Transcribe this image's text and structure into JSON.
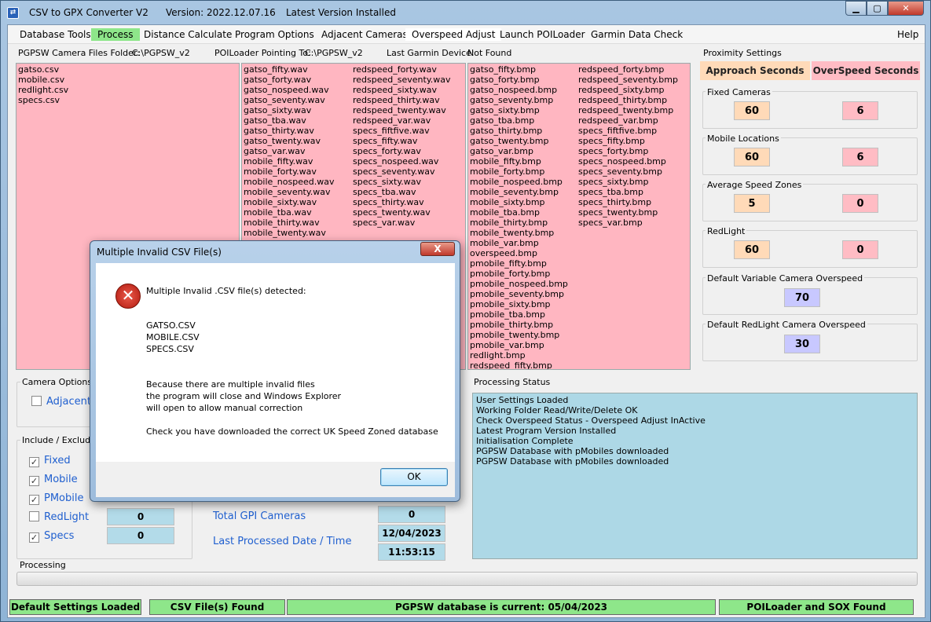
{
  "titlebar": {
    "app": "CSV to GPX Converter V2",
    "version": "Version: 2022.12.07.16",
    "status": "Latest Version Installed",
    "icon": "app-icon",
    "minimize": "minimize-icon",
    "maximize": "maximize-icon",
    "close": "close-icon"
  },
  "menu": [
    "Database Tools",
    "Process",
    "Distance Calculate",
    "Program Options",
    "Adjacent Cameras",
    "Overspeed Adjust",
    "Launch POILoader",
    "Garmin Data Check",
    "Help"
  ],
  "info": {
    "camera_folder_label": "PGPSW Camera Files Folder:",
    "camera_folder": "C:\\PGPSW_v2",
    "poiloader_label": "POILoader Pointing To:",
    "poiloader": "C:\\PGPSW_v2",
    "garmin_label": "Last Garmin Device:",
    "garmin": "Not Found"
  },
  "csv_files": [
    "gatso.csv",
    "mobile.csv",
    "redlight.csv",
    "specs.csv"
  ],
  "wav_col1": [
    "gatso_fifty.wav",
    "gatso_forty.wav",
    "gatso_nospeed.wav",
    "gatso_seventy.wav",
    "gatso_sixty.wav",
    "gatso_tba.wav",
    "gatso_thirty.wav",
    "gatso_twenty.wav",
    "gatso_var.wav",
    "mobile_fifty.wav",
    "mobile_forty.wav",
    "mobile_nospeed.wav",
    "mobile_seventy.wav",
    "mobile_sixty.wav",
    "mobile_tba.wav",
    "mobile_thirty.wav",
    "mobile_twenty.wav"
  ],
  "wav_col2": [
    "redspeed_forty.wav",
    "redspeed_seventy.wav",
    "redspeed_sixty.wav",
    "redspeed_thirty.wav",
    "redspeed_twenty.wav",
    "redspeed_var.wav",
    "specs_fiftfive.wav",
    "specs_fifty.wav",
    "specs_forty.wav",
    "specs_nospeed.wav",
    "specs_seventy.wav",
    "specs_sixty.wav",
    "specs_tba.wav",
    "specs_thirty.wav",
    "specs_twenty.wav",
    "specs_var.wav"
  ],
  "bmp_col1": [
    "gatso_fifty.bmp",
    "gatso_forty.bmp",
    "gatso_nospeed.bmp",
    "gatso_seventy.bmp",
    "gatso_sixty.bmp",
    "gatso_tba.bmp",
    "gatso_thirty.bmp",
    "gatso_twenty.bmp",
    "gatso_var.bmp",
    "mobile_fifty.bmp",
    "mobile_forty.bmp",
    "mobile_nospeed.bmp",
    "mobile_seventy.bmp",
    "mobile_sixty.bmp",
    "mobile_tba.bmp",
    "mobile_thirty.bmp",
    "mobile_twenty.bmp",
    "mobile_var.bmp",
    "overspeed.bmp",
    "pmobile_fifty.bmp",
    "pmobile_forty.bmp",
    "pmobile_nospeed.bmp",
    "pmobile_seventy.bmp",
    "pmobile_sixty.bmp",
    "pmobile_tba.bmp",
    "pmobile_thirty.bmp",
    "pmobile_twenty.bmp",
    "pmobile_var.bmp",
    "redlight.bmp",
    "redspeed_fifty.bmp"
  ],
  "bmp_col2": [
    "redspeed_forty.bmp",
    "redspeed_seventy.bmp",
    "redspeed_sixty.bmp",
    "redspeed_thirty.bmp",
    "redspeed_twenty.bmp",
    "redspeed_var.bmp",
    "specs_fiftfive.bmp",
    "specs_fifty.bmp",
    "specs_forty.bmp",
    "specs_nospeed.bmp",
    "specs_seventy.bmp",
    "specs_sixty.bmp",
    "specs_tba.bmp",
    "specs_thirty.bmp",
    "specs_twenty.bmp",
    "specs_var.bmp"
  ],
  "proximity": {
    "title": "Proximity Settings",
    "approach_label": "Approach Seconds",
    "overspeed_label": "OverSpeed Seconds",
    "fixed": {
      "label": "Fixed Cameras",
      "approach": "60",
      "overspeed": "6"
    },
    "mobile": {
      "label": "Mobile Locations",
      "approach": "60",
      "overspeed": "6"
    },
    "average": {
      "label": "Average Speed Zones",
      "approach": "5",
      "overspeed": "0"
    },
    "redlight": {
      "label": "RedLight",
      "approach": "60",
      "overspeed": "0"
    },
    "var_overspeed": {
      "label": "Default Variable Camera Overspeed",
      "value": "70"
    },
    "redlight_overspeed": {
      "label": "Default RedLight Camera Overspeed",
      "value": "30"
    }
  },
  "camera_options": {
    "title": "Camera Options",
    "adjacent": "Adjacent"
  },
  "include": {
    "title": "Include / Exclude",
    "items": [
      {
        "label": "Fixed",
        "checked": "✓"
      },
      {
        "label": "Mobile",
        "checked": "✓"
      },
      {
        "label": "PMobile",
        "checked": "✓"
      },
      {
        "label": "RedLight",
        "checked": "",
        "count": "0"
      },
      {
        "label": "Specs",
        "checked": "✓",
        "count": "0"
      }
    ]
  },
  "totals": {
    "gpi_label": "Total GPI Cameras",
    "gpi_value": "0",
    "date_label": "Last Processed Date / Time",
    "date": "12/04/2023",
    "time": "11:53:15"
  },
  "processing_status": {
    "title": "Processing Status",
    "lines": [
      "User Settings Loaded",
      "Working Folder Read/Write/Delete OK",
      "Check Overspeed Status - Overspeed Adjust InActive",
      "Latest Program Version Installed",
      "Initialisation Complete",
      "PGPSW Database with pMobiles downloaded",
      "PGPSW Database with pMobiles downloaded"
    ]
  },
  "processing_label": "Processing",
  "statusbar": [
    "Default Settings Loaded",
    "CSV File(s) Found",
    "PGPSW database is current: 05/04/2023",
    "POILoader and SOX Found"
  ],
  "dialog": {
    "title": "Multiple Invalid CSV File(s)",
    "close": "X",
    "icon": "error-icon",
    "heading": "Multiple Invalid .CSV file(s) detected:",
    "files": [
      "GATSO.CSV",
      "MOBILE.CSV",
      "SPECS.CSV"
    ],
    "body": [
      "Because there are multiple invalid files",
      "the program will close and Windows Explorer",
      "will open to allow manual correction"
    ],
    "note": "Check you have downloaded the correct UK Speed Zoned database",
    "ok": "OK"
  },
  "colors": {
    "pink": "#ffb6c1",
    "green": "#8ee68a",
    "peach": "#ffdab8",
    "rose": "#ffbcc4",
    "lavender": "#c8c8ff",
    "lightblue": "#add8e6"
  }
}
